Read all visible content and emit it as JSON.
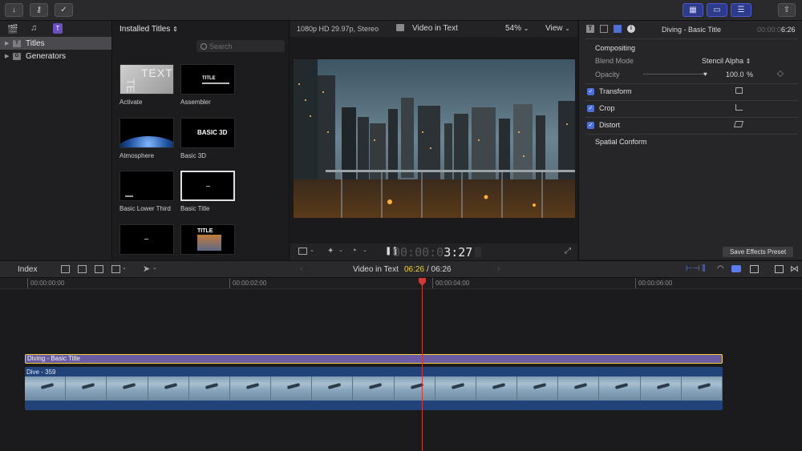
{
  "colors": {
    "accent": "#4e6fd6",
    "title_clip": "#6b5ba4",
    "title_clip_border": "#f1d23a",
    "video_clip": "#22427a",
    "playhead": "#d03a3a"
  },
  "toolbar": {
    "left_icons": [
      "import-icon",
      "key-icon",
      "check-icon"
    ],
    "right_icons": [
      "browser-view-icon",
      "timeline-view-icon",
      "inspector-view-icon",
      "share-icon"
    ]
  },
  "sidebar": {
    "icons": [
      "clapper-icon",
      "music-icon",
      "titles-generators-icon"
    ],
    "items": [
      {
        "label": "Titles",
        "icon": "T"
      },
      {
        "label": "Generators",
        "icon": "G"
      }
    ]
  },
  "browser": {
    "title": "Installed Titles",
    "search_placeholder": "Search",
    "thumbs": [
      {
        "label": "Activate",
        "text": "TEXT"
      },
      {
        "label": "Assembler",
        "text": "TITLE"
      },
      {
        "label": "Atmosphere",
        "text": ""
      },
      {
        "label": "Basic 3D",
        "text": "BASIC 3D"
      },
      {
        "label": "Basic Lower Third",
        "text": ""
      },
      {
        "label": "Basic Title",
        "text": ""
      },
      {
        "label": "",
        "text": ""
      },
      {
        "label": "",
        "text": "TITLE"
      }
    ]
  },
  "viewer": {
    "format": "1080p HD 29.97p, Stereo",
    "project": "Video in Text",
    "zoom": "54%",
    "view": "View",
    "timecode_dim": "00:00:0",
    "timecode_bright": "3:27"
  },
  "inspector": {
    "clip_name": "Diving - Basic Title",
    "timecode_dim": "00:00:0",
    "timecode_bright": "6:26",
    "section": "Compositing",
    "blend_mode_label": "Blend Mode",
    "blend_mode_value": "Stencil Alpha",
    "opacity_label": "Opacity",
    "opacity_value": "100.0",
    "opacity_unit": "%",
    "transform": "Transform",
    "crop": "Crop",
    "distort": "Distort",
    "spatial_conform": "Spatial Conform",
    "save_preset": "Save Effects Preset"
  },
  "timeline": {
    "index": "Index",
    "project": "Video in Text",
    "current_time": "06:26",
    "total_time": "/ 06:26",
    "ruler": [
      "00:00:00:00",
      "00:00:02:00",
      "00:00:04:00",
      "00:00:06:00"
    ],
    "title_clip": "Diving - Basic Title",
    "video_clip": "Dive - 359"
  }
}
